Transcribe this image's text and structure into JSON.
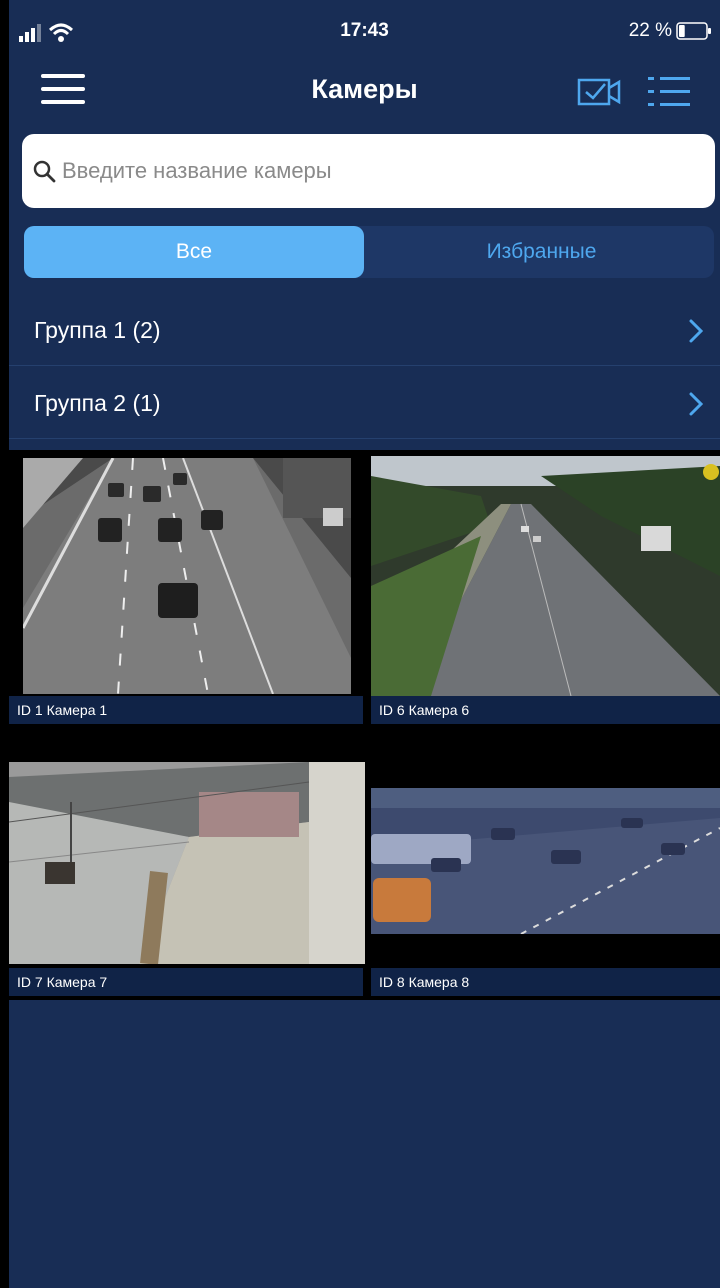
{
  "status_bar": {
    "time": "17:43",
    "battery_percent": "22 %",
    "battery_level": 0.22,
    "icons": [
      "signal-icon",
      "wifi-icon",
      "battery-icon"
    ]
  },
  "nav": {
    "title": "Камеры",
    "icons": [
      "hamburger-menu-icon",
      "camera-select-icon",
      "list-view-icon"
    ]
  },
  "search": {
    "placeholder": "Введите название камеры",
    "value": ""
  },
  "tabs": [
    {
      "label": "Все",
      "selected": true
    },
    {
      "label": "Избранные",
      "selected": false
    }
  ],
  "groups": [
    {
      "label": "Группа 1 (2)"
    },
    {
      "label": "Группа 2 (1)"
    }
  ],
  "cameras": [
    {
      "label": "ID 1 Камера  1",
      "scene": "highway"
    },
    {
      "label": "ID 6 Камера 6",
      "scene": "road"
    },
    {
      "label": "ID 7 Камера 7",
      "scene": "warehouse"
    },
    {
      "label": "ID 8 Камера 8",
      "scene": "intersection"
    }
  ],
  "colors": {
    "background": "#182d55",
    "accent": "#5cb3f5",
    "accent_text": "#4ea7ee"
  }
}
